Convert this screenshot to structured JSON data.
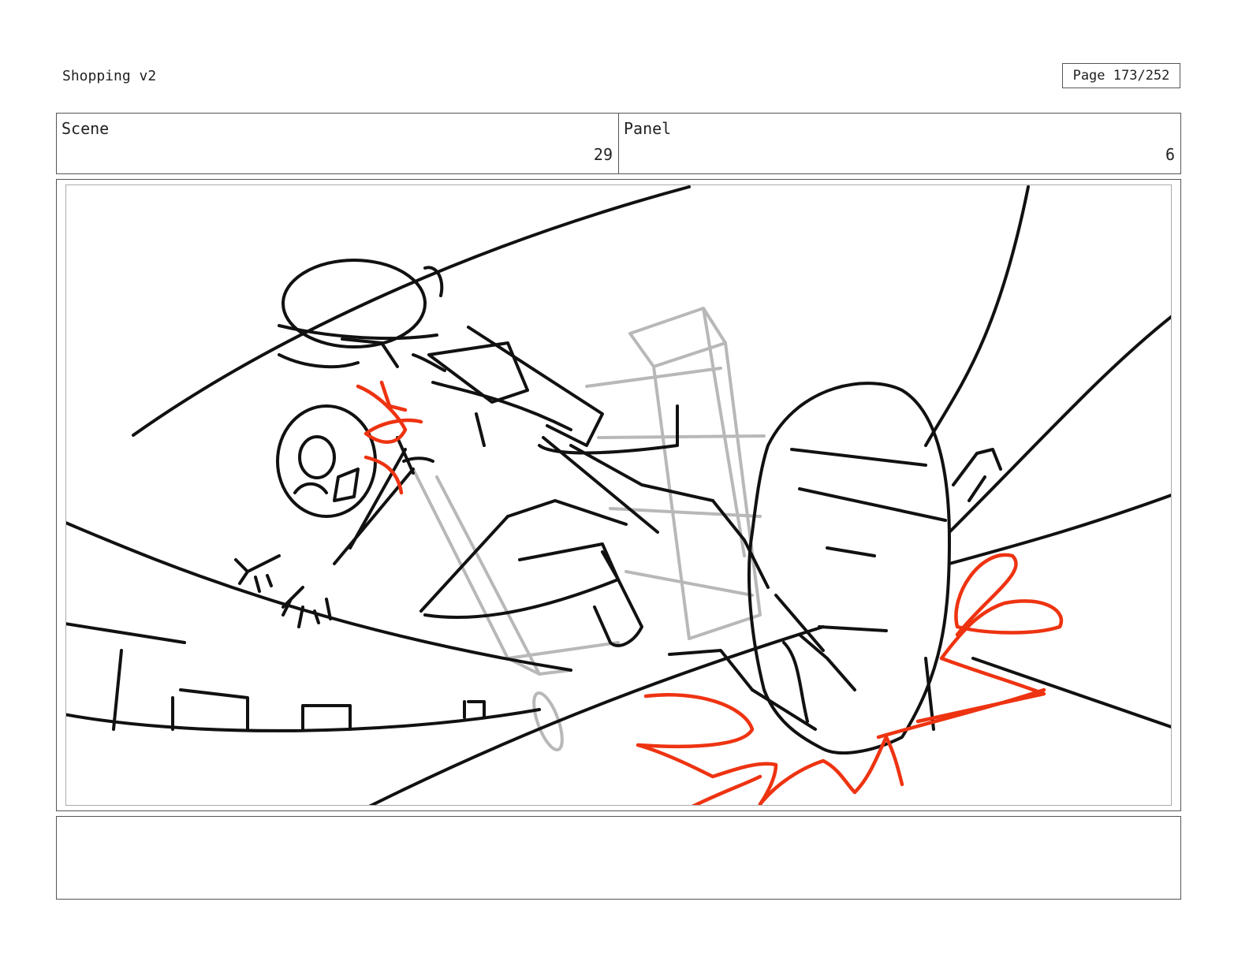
{
  "document": {
    "title": "Shopping v2",
    "page_label": "Page 173/252"
  },
  "info": {
    "scene_label": "Scene",
    "scene_number": "29",
    "panel_label": "Panel",
    "panel_number": "6"
  },
  "sketch": {
    "ink_color": "#111111",
    "construction_color": "#b8b8b8",
    "impact_color": "#ee3311"
  },
  "notes": {
    "text": ""
  }
}
